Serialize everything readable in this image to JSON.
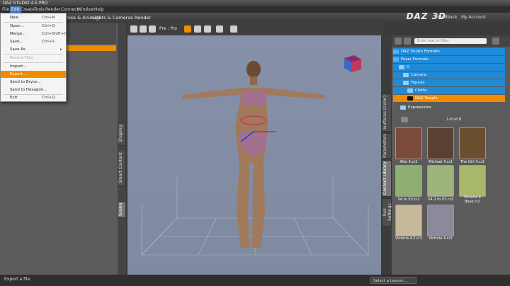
{
  "title": "DAZ STUDIO 4.5 PRO",
  "menubar": [
    "File",
    "Edit",
    "Create",
    "Tools",
    "Render",
    "Connect",
    "Window",
    "Help"
  ],
  "main_tabs": [
    "Pose & Animate",
    "Lights & Cameras",
    "Render"
  ],
  "logo": "DAZ 3D",
  "header_links": [
    "Feedback",
    "My Account"
  ],
  "file_menu": [
    {
      "label": "New",
      "shortcut": "Ctrl+N"
    },
    {
      "label": "Open...",
      "shortcut": "Ctrl+O"
    },
    {
      "label": "Merge...",
      "shortcut": "Ctrl+Shift+O"
    },
    {
      "label": "Save...",
      "shortcut": "Ctrl+S"
    },
    {
      "label": "Save As",
      "shortcut": "",
      "submenu": true
    },
    {
      "label": "Recent Files",
      "shortcut": "",
      "disabled": true
    },
    {
      "label": "Import...",
      "shortcut": ""
    },
    {
      "label": "Export...",
      "shortcut": "",
      "highlighted": true
    },
    {
      "label": "Send to Bryce...",
      "shortcut": ""
    },
    {
      "label": "Send to Hexagon...",
      "shortcut": ""
    },
    {
      "label": "Exit",
      "shortcut": "Ctrl+Q"
    }
  ],
  "viewport": {
    "camera_label": "Pre : Pro"
  },
  "left_vertical_tabs": [
    "Shaping",
    "Smart Content",
    "Scene"
  ],
  "right_vertical_tabs": [
    "Surfaces (Color)",
    "Parameters",
    "Content Library",
    "Tool Settings"
  ],
  "content_library": {
    "search_placeholder": "Enter text to filter",
    "tree": [
      {
        "label": "DAZ Studio Formats",
        "state": "sel"
      },
      {
        "label": "Poser Formats",
        "state": "sel"
      },
      {
        "label": "D",
        "state": "sel"
      },
      {
        "label": "Camera",
        "state": "sel"
      },
      {
        "label": "Figures",
        "state": "sel"
      },
      {
        "label": "Cloths",
        "state": "sel"
      },
      {
        "label": "DAZ People",
        "state": "hl"
      },
      {
        "label": "Expressions",
        "state": "plain"
      }
    ],
    "page_info": "1-8 of 8",
    "thumbnails": [
      {
        "label": "Aiko 4.cr2",
        "color": "#7a4a3a"
      },
      {
        "label": "Michael 4.cr2",
        "color": "#5a4030"
      },
      {
        "label": "The Girl 4.cr2",
        "color": "#6a5030"
      },
      {
        "label": "V4 to V3.cr2",
        "color": "#8fae72"
      },
      {
        "label": "V4.2 to V3.cr2",
        "color": "#9fb47a"
      },
      {
        "label": "Victoria 4 Base.cr2",
        "color": "#a8b86a"
      },
      {
        "label": "Victoria 4.2.cr2",
        "color": "#c8b89a"
      },
      {
        "label": "Victoria 4.cr2",
        "color": "#8a8a9a"
      }
    ]
  },
  "status": {
    "text": "Export a file",
    "lesson": "Select a Lesson..."
  }
}
